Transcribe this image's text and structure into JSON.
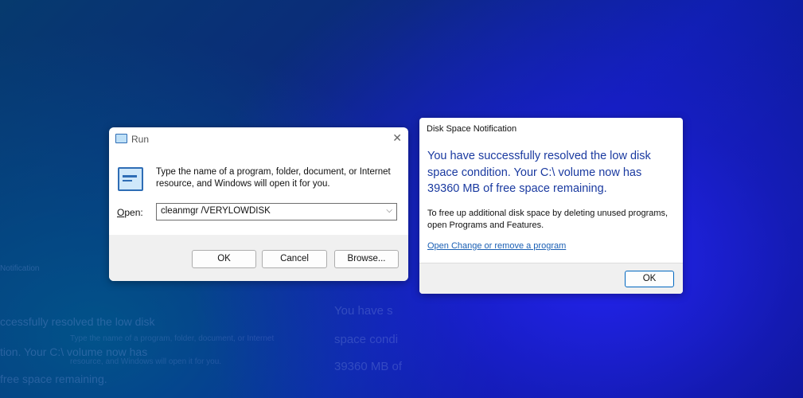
{
  "background_text": {
    "line1": "ccessfully resolved the low disk",
    "line2": "tion. Your C:\\ volume now has",
    "line3": "free space remaining.",
    "right1": "You have s",
    "right2": "space condi",
    "right3": "39360 MB of",
    "small1": "Notification",
    "small2": "Type the name of a program, folder, document, or Internet",
    "small3": "resource, and Windows will open it for you."
  },
  "run_dialog": {
    "title": "Run",
    "close_glyph": "✕",
    "description": "Type the name of a program, folder, document, or Internet resource, and Windows will open it for you.",
    "open_label_underlined": "O",
    "open_label_rest": "pen:",
    "open_value": "cleanmgr /VERYLOWDISK",
    "dropdown_glyph": "⌵",
    "ok_label": "OK",
    "cancel_label": "Cancel",
    "browse_label": "Browse..."
  },
  "disk_dialog": {
    "title": "Disk Space Notification",
    "heading": "You have successfully resolved the low disk space condition. Your C:\\ volume now has 39360 MB of free space remaining.",
    "body": "To free up additional disk space by deleting unused programs, open Programs and Features.",
    "link": "Open Change or remove a program",
    "ok_label": "OK"
  },
  "colors": {
    "heading": "#1a3aa0",
    "link": "#1a5fb4",
    "accent_border": "#0067c0"
  }
}
